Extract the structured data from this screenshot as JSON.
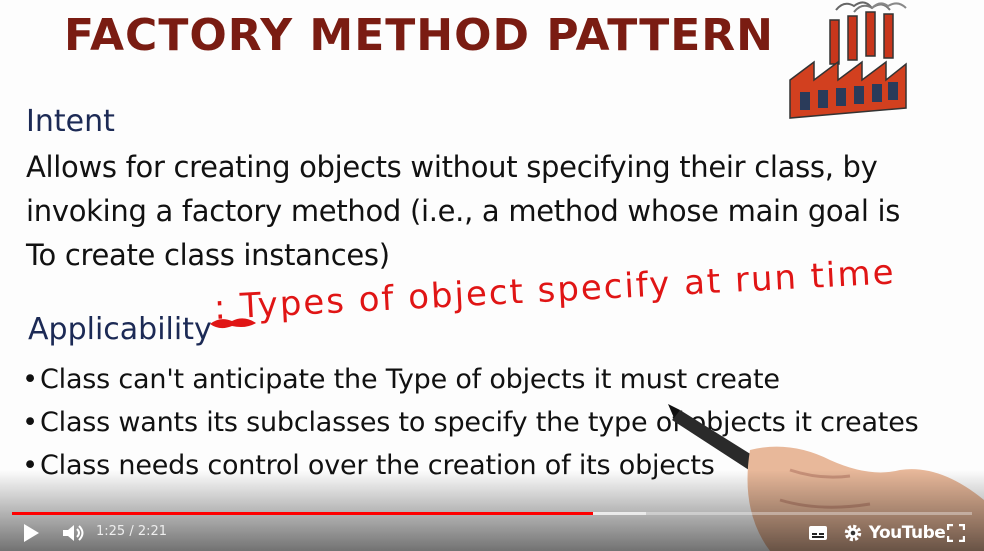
{
  "slide": {
    "title": "FACTORY METHOD PATTERN",
    "intent_heading": "Intent",
    "intent_lines": [
      "Allows for creating objects without specifying their class, by",
      "invoking a factory method (i.e., a method whose main goal is",
      "To create class instances)"
    ],
    "applicability_heading": "Applicability",
    "applicability_note": ": Types of object specify at run time",
    "bullets": [
      "Class can't anticipate the Type of objects it must create",
      "Class wants its subclasses to specify the type of objects it creates",
      "Class needs control over the creation of its objects"
    ],
    "bullet_symbol": "•",
    "colors": {
      "title": "#7a1c12",
      "heading": "#1c2a55",
      "note": "#e01515",
      "factory": "#c8361c"
    }
  },
  "player": {
    "current_time": "1:25",
    "separator": "/",
    "duration": "2:21",
    "progress_played_fraction": 0.605,
    "progress_buffered_fraction": 0.66,
    "brand_label": "YouTube",
    "progress_color": "#ff0000",
    "icons": {
      "play": "play-icon",
      "volume": "volume-icon",
      "captions": "captions-icon",
      "settings": "gear-icon",
      "fullscreen": "fullscreen-icon"
    }
  }
}
